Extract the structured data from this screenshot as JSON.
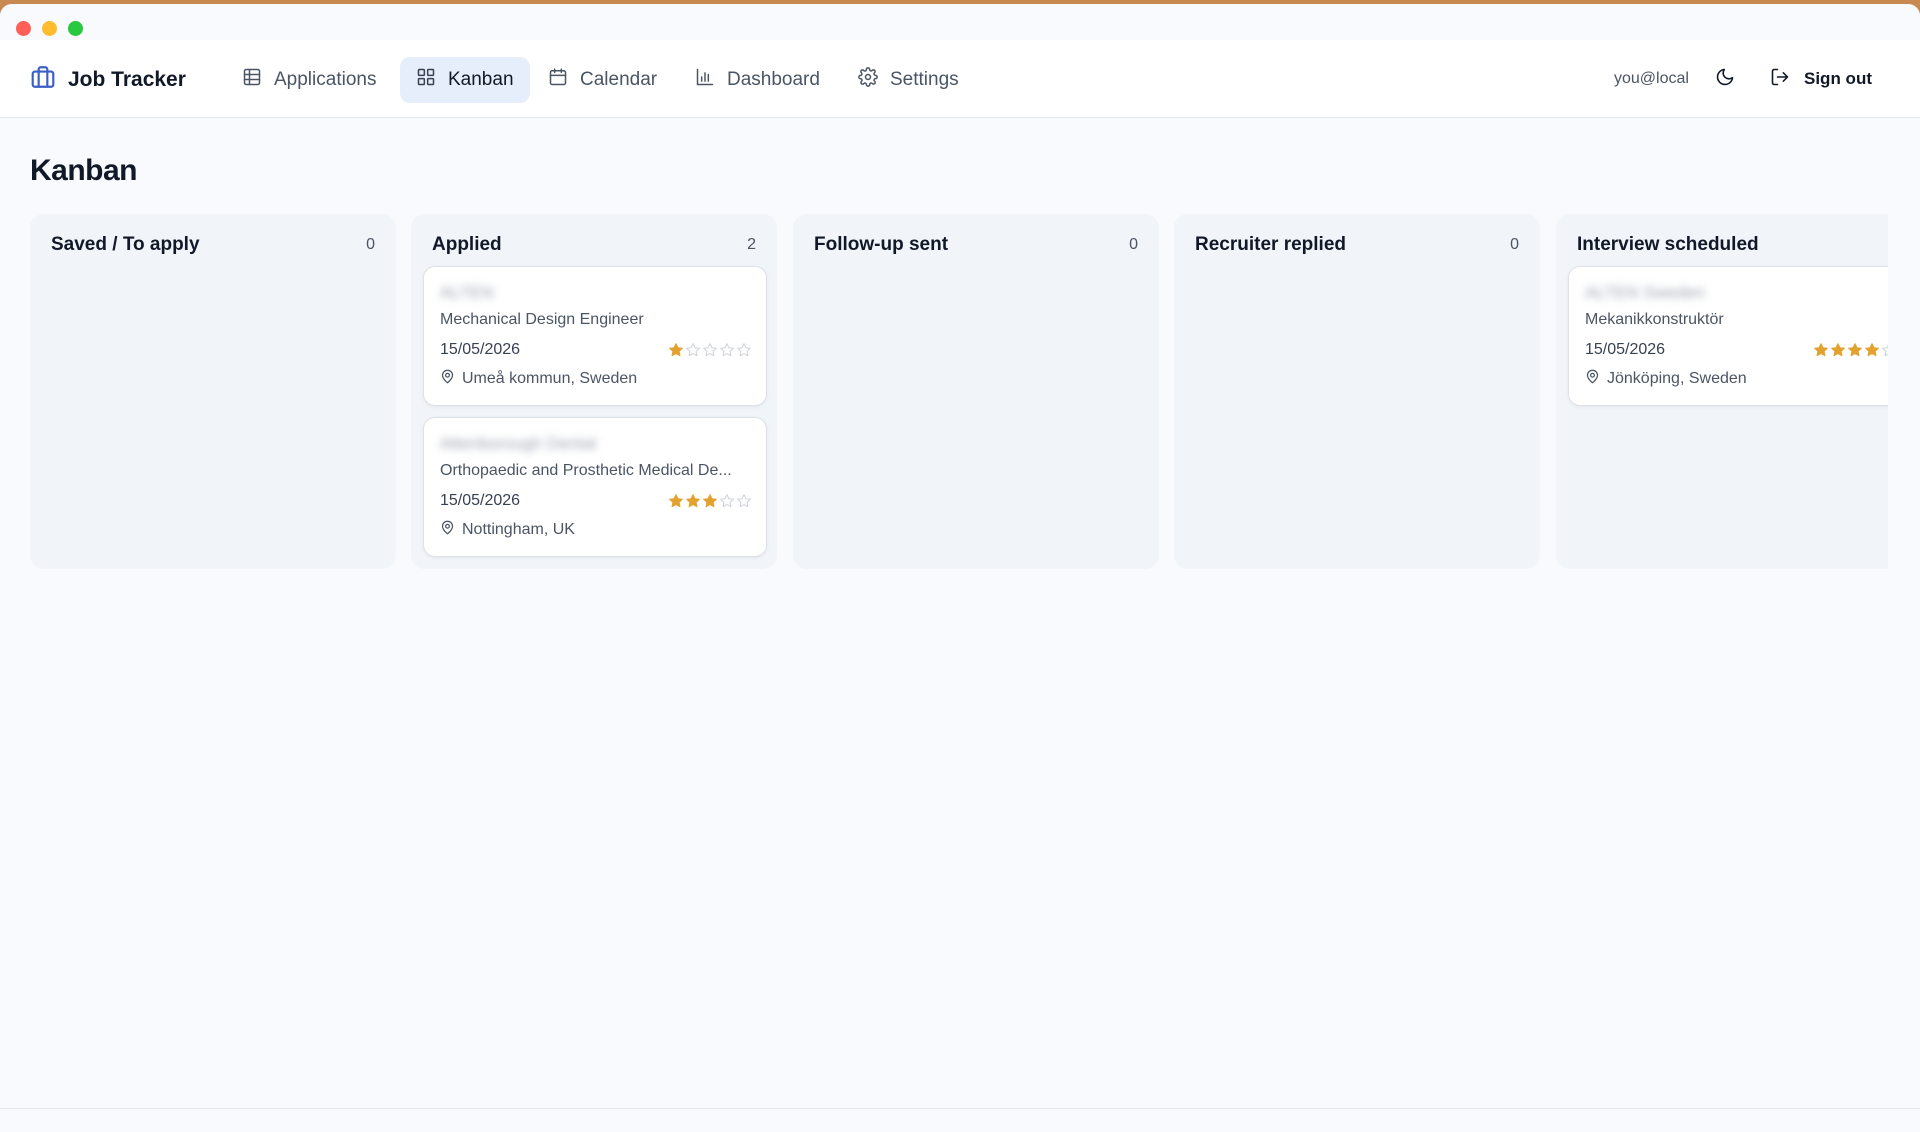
{
  "app": {
    "brand_name": "Job Tracker",
    "brand_icon": "briefcase-icon",
    "accent_color": "#3b5fc4"
  },
  "nav": {
    "items": [
      {
        "label": "Applications",
        "icon": "table-icon"
      },
      {
        "label": "Kanban",
        "icon": "grid-icon",
        "active": true
      },
      {
        "label": "Calendar",
        "icon": "calendar-icon"
      },
      {
        "label": "Dashboard",
        "icon": "bar-chart-icon"
      },
      {
        "label": "Settings",
        "icon": "gear-icon"
      }
    ]
  },
  "user": {
    "email": "you@local",
    "theme_icon": "moon-icon",
    "signout_label": "Sign out",
    "signout_icon": "logout-icon"
  },
  "page": {
    "title": "Kanban"
  },
  "columns": [
    {
      "title": "Saved / To apply",
      "count": "0",
      "cards": []
    },
    {
      "title": "Applied",
      "count": "2",
      "cards": [
        {
          "company": "ALTEN",
          "role": "Mechanical Design Engineer",
          "date": "15/05/2026",
          "rating": 1,
          "location": "Umeå kommun, Sweden"
        },
        {
          "company": "Attenborough Dental",
          "role": "Orthopaedic and Prosthetic Medical De...",
          "date": "15/05/2026",
          "rating": 3,
          "location": "Nottingham, UK"
        }
      ]
    },
    {
      "title": "Follow-up sent",
      "count": "0",
      "cards": []
    },
    {
      "title": "Recruiter replied",
      "count": "0",
      "cards": []
    },
    {
      "title": "Interview scheduled",
      "count": "",
      "cards": [
        {
          "company": "ALTEN Sweden",
          "role": "Mekanikkonstruktör",
          "date": "15/05/2026",
          "rating": 4,
          "location": "Jönköping, Sweden"
        }
      ]
    }
  ],
  "colors": {
    "star_filled": "#e3a230",
    "star_empty": "#cfd3d9",
    "active_tab_bg": "#e6eefb"
  }
}
